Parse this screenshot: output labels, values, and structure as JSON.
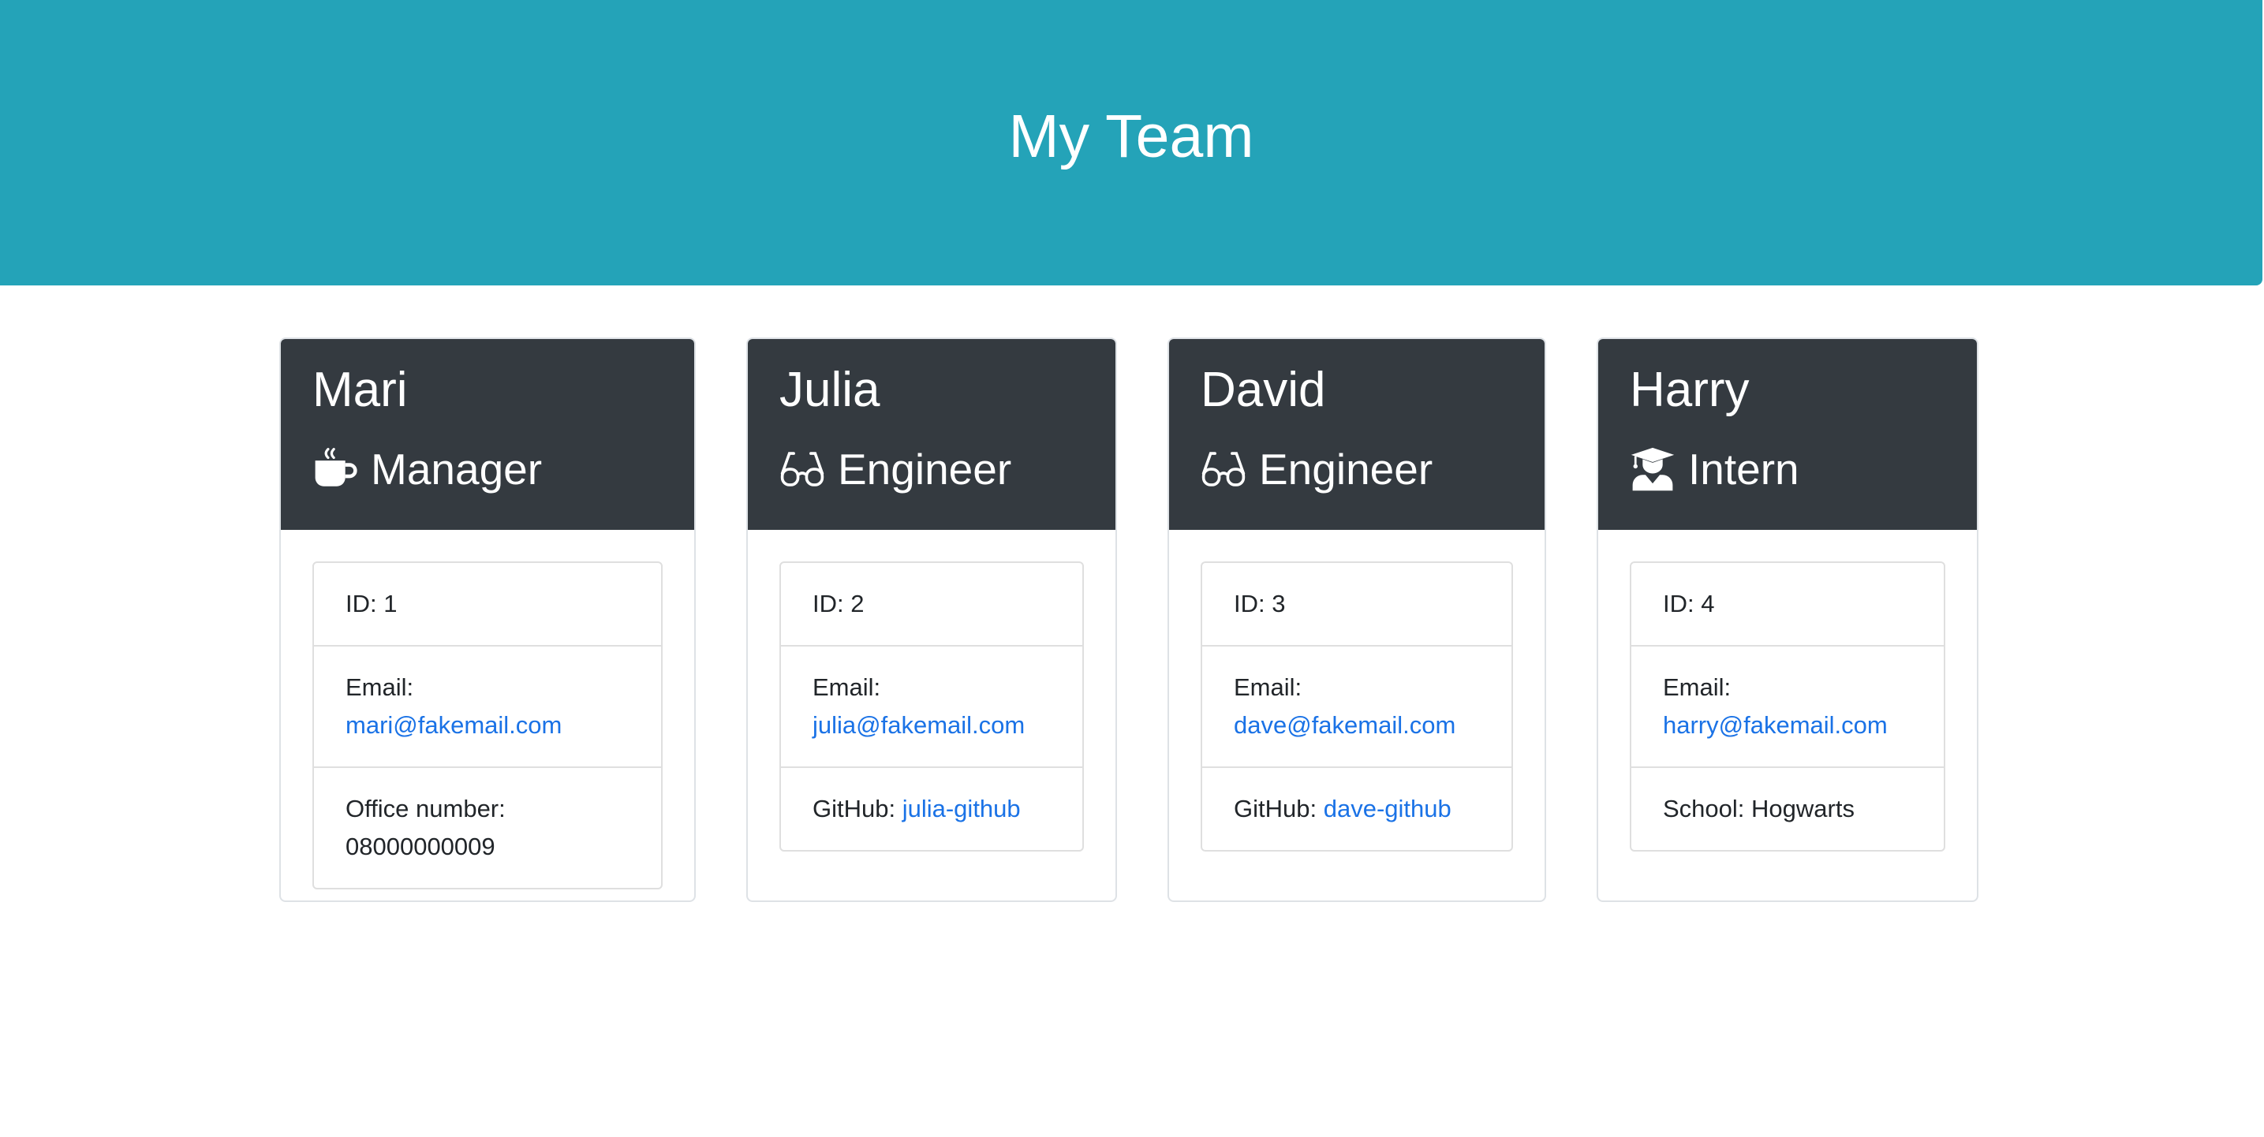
{
  "header": {
    "title": "My Team",
    "background": "#24a3b8"
  },
  "members": [
    {
      "name": "Mari",
      "role": "Manager",
      "role_icon": "coffee-icon",
      "id_text": "ID: 1",
      "email_label": "Email:",
      "email": "mari@fakemail.com",
      "extra_label": "Office number:",
      "extra_value": "08000000009"
    },
    {
      "name": "Julia",
      "role": "Engineer",
      "role_icon": "glasses-icon",
      "id_text": "ID: 2",
      "email_label": "Email:",
      "email": "julia@fakemail.com",
      "extra_label": "GitHub:",
      "extra_value": "julia-github"
    },
    {
      "name": "David",
      "role": "Engineer",
      "role_icon": "glasses-icon",
      "id_text": "ID: 3",
      "email_label": "Email:",
      "email": "dave@fakemail.com",
      "extra_label": "GitHub:",
      "extra_value": "dave-github"
    },
    {
      "name": "Harry",
      "role": "Intern",
      "role_icon": "graduate-icon",
      "id_text": "ID: 4",
      "email_label": "Email:",
      "email": "harry@fakemail.com",
      "extra_label": "School:",
      "extra_value": "Hogwarts"
    }
  ],
  "colors": {
    "card_header": "#343a40",
    "link": "#1a72e6"
  }
}
